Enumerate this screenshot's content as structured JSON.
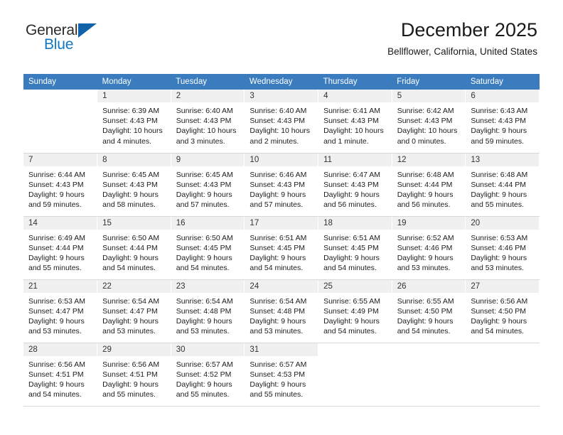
{
  "brand": {
    "name_line1": "General",
    "name_line2": "Blue",
    "logo_icon": "triangle-flag-icon"
  },
  "header": {
    "title": "December 2025",
    "subtitle": "Bellflower, California, United States"
  },
  "colors": {
    "header_row_bg": "#3a7cbe",
    "header_row_text": "#ffffff",
    "daynum_bg": "#f0f0f0",
    "brand_blue": "#1277c4",
    "logo_blue": "#1162a8",
    "grid_line": "#d8d8d8"
  },
  "weekday_headers": [
    "Sunday",
    "Monday",
    "Tuesday",
    "Wednesday",
    "Thursday",
    "Friday",
    "Saturday"
  ],
  "weeks": [
    [
      {
        "day": "",
        "sunrise": "",
        "sunset": "",
        "daylight1": "",
        "daylight2": "",
        "empty": true
      },
      {
        "day": "1",
        "sunrise": "Sunrise: 6:39 AM",
        "sunset": "Sunset: 4:43 PM",
        "daylight1": "Daylight: 10 hours",
        "daylight2": "and 4 minutes."
      },
      {
        "day": "2",
        "sunrise": "Sunrise: 6:40 AM",
        "sunset": "Sunset: 4:43 PM",
        "daylight1": "Daylight: 10 hours",
        "daylight2": "and 3 minutes."
      },
      {
        "day": "3",
        "sunrise": "Sunrise: 6:40 AM",
        "sunset": "Sunset: 4:43 PM",
        "daylight1": "Daylight: 10 hours",
        "daylight2": "and 2 minutes."
      },
      {
        "day": "4",
        "sunrise": "Sunrise: 6:41 AM",
        "sunset": "Sunset: 4:43 PM",
        "daylight1": "Daylight: 10 hours",
        "daylight2": "and 1 minute."
      },
      {
        "day": "5",
        "sunrise": "Sunrise: 6:42 AM",
        "sunset": "Sunset: 4:43 PM",
        "daylight1": "Daylight: 10 hours",
        "daylight2": "and 0 minutes."
      },
      {
        "day": "6",
        "sunrise": "Sunrise: 6:43 AM",
        "sunset": "Sunset: 4:43 PM",
        "daylight1": "Daylight: 9 hours",
        "daylight2": "and 59 minutes."
      }
    ],
    [
      {
        "day": "7",
        "sunrise": "Sunrise: 6:44 AM",
        "sunset": "Sunset: 4:43 PM",
        "daylight1": "Daylight: 9 hours",
        "daylight2": "and 59 minutes."
      },
      {
        "day": "8",
        "sunrise": "Sunrise: 6:45 AM",
        "sunset": "Sunset: 4:43 PM",
        "daylight1": "Daylight: 9 hours",
        "daylight2": "and 58 minutes."
      },
      {
        "day": "9",
        "sunrise": "Sunrise: 6:45 AM",
        "sunset": "Sunset: 4:43 PM",
        "daylight1": "Daylight: 9 hours",
        "daylight2": "and 57 minutes."
      },
      {
        "day": "10",
        "sunrise": "Sunrise: 6:46 AM",
        "sunset": "Sunset: 4:43 PM",
        "daylight1": "Daylight: 9 hours",
        "daylight2": "and 57 minutes."
      },
      {
        "day": "11",
        "sunrise": "Sunrise: 6:47 AM",
        "sunset": "Sunset: 4:43 PM",
        "daylight1": "Daylight: 9 hours",
        "daylight2": "and 56 minutes."
      },
      {
        "day": "12",
        "sunrise": "Sunrise: 6:48 AM",
        "sunset": "Sunset: 4:44 PM",
        "daylight1": "Daylight: 9 hours",
        "daylight2": "and 56 minutes."
      },
      {
        "day": "13",
        "sunrise": "Sunrise: 6:48 AM",
        "sunset": "Sunset: 4:44 PM",
        "daylight1": "Daylight: 9 hours",
        "daylight2": "and 55 minutes."
      }
    ],
    [
      {
        "day": "14",
        "sunrise": "Sunrise: 6:49 AM",
        "sunset": "Sunset: 4:44 PM",
        "daylight1": "Daylight: 9 hours",
        "daylight2": "and 55 minutes."
      },
      {
        "day": "15",
        "sunrise": "Sunrise: 6:50 AM",
        "sunset": "Sunset: 4:44 PM",
        "daylight1": "Daylight: 9 hours",
        "daylight2": "and 54 minutes."
      },
      {
        "day": "16",
        "sunrise": "Sunrise: 6:50 AM",
        "sunset": "Sunset: 4:45 PM",
        "daylight1": "Daylight: 9 hours",
        "daylight2": "and 54 minutes."
      },
      {
        "day": "17",
        "sunrise": "Sunrise: 6:51 AM",
        "sunset": "Sunset: 4:45 PM",
        "daylight1": "Daylight: 9 hours",
        "daylight2": "and 54 minutes."
      },
      {
        "day": "18",
        "sunrise": "Sunrise: 6:51 AM",
        "sunset": "Sunset: 4:45 PM",
        "daylight1": "Daylight: 9 hours",
        "daylight2": "and 54 minutes."
      },
      {
        "day": "19",
        "sunrise": "Sunrise: 6:52 AM",
        "sunset": "Sunset: 4:46 PM",
        "daylight1": "Daylight: 9 hours",
        "daylight2": "and 53 minutes."
      },
      {
        "day": "20",
        "sunrise": "Sunrise: 6:53 AM",
        "sunset": "Sunset: 4:46 PM",
        "daylight1": "Daylight: 9 hours",
        "daylight2": "and 53 minutes."
      }
    ],
    [
      {
        "day": "21",
        "sunrise": "Sunrise: 6:53 AM",
        "sunset": "Sunset: 4:47 PM",
        "daylight1": "Daylight: 9 hours",
        "daylight2": "and 53 minutes."
      },
      {
        "day": "22",
        "sunrise": "Sunrise: 6:54 AM",
        "sunset": "Sunset: 4:47 PM",
        "daylight1": "Daylight: 9 hours",
        "daylight2": "and 53 minutes."
      },
      {
        "day": "23",
        "sunrise": "Sunrise: 6:54 AM",
        "sunset": "Sunset: 4:48 PM",
        "daylight1": "Daylight: 9 hours",
        "daylight2": "and 53 minutes."
      },
      {
        "day": "24",
        "sunrise": "Sunrise: 6:54 AM",
        "sunset": "Sunset: 4:48 PM",
        "daylight1": "Daylight: 9 hours",
        "daylight2": "and 53 minutes."
      },
      {
        "day": "25",
        "sunrise": "Sunrise: 6:55 AM",
        "sunset": "Sunset: 4:49 PM",
        "daylight1": "Daylight: 9 hours",
        "daylight2": "and 54 minutes."
      },
      {
        "day": "26",
        "sunrise": "Sunrise: 6:55 AM",
        "sunset": "Sunset: 4:50 PM",
        "daylight1": "Daylight: 9 hours",
        "daylight2": "and 54 minutes."
      },
      {
        "day": "27",
        "sunrise": "Sunrise: 6:56 AM",
        "sunset": "Sunset: 4:50 PM",
        "daylight1": "Daylight: 9 hours",
        "daylight2": "and 54 minutes."
      }
    ],
    [
      {
        "day": "28",
        "sunrise": "Sunrise: 6:56 AM",
        "sunset": "Sunset: 4:51 PM",
        "daylight1": "Daylight: 9 hours",
        "daylight2": "and 54 minutes."
      },
      {
        "day": "29",
        "sunrise": "Sunrise: 6:56 AM",
        "sunset": "Sunset: 4:51 PM",
        "daylight1": "Daylight: 9 hours",
        "daylight2": "and 55 minutes."
      },
      {
        "day": "30",
        "sunrise": "Sunrise: 6:57 AM",
        "sunset": "Sunset: 4:52 PM",
        "daylight1": "Daylight: 9 hours",
        "daylight2": "and 55 minutes."
      },
      {
        "day": "31",
        "sunrise": "Sunrise: 6:57 AM",
        "sunset": "Sunset: 4:53 PM",
        "daylight1": "Daylight: 9 hours",
        "daylight2": "and 55 minutes."
      },
      {
        "day": "",
        "sunrise": "",
        "sunset": "",
        "daylight1": "",
        "daylight2": "",
        "empty": true
      },
      {
        "day": "",
        "sunrise": "",
        "sunset": "",
        "daylight1": "",
        "daylight2": "",
        "empty": true
      },
      {
        "day": "",
        "sunrise": "",
        "sunset": "",
        "daylight1": "",
        "daylight2": "",
        "empty": true
      }
    ]
  ]
}
